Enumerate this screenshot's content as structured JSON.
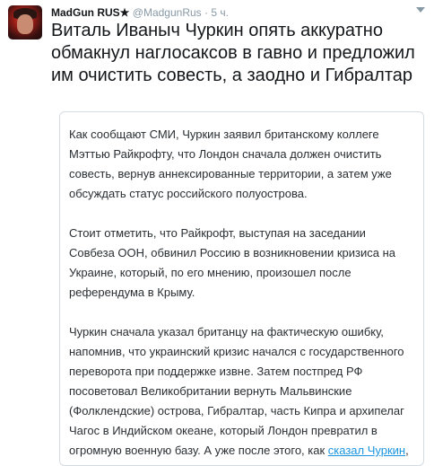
{
  "tweet": {
    "author_name": "MadGun RUS★",
    "handle": "@MadgunRus",
    "separator": "·",
    "time": "5 ч.",
    "text": "Виталь Иваныч Чуркин опять аккуратно обмакнул наглосаксов в гавно и предложил им очистить совесть, а заодно и Гибралтар"
  },
  "quote": {
    "paragraph_1": "Как сообщают СМИ, Чуркин заявил британскому коллеге Мэттью Райкрофту, что Лондон сначала должен очистить совесть, вернув аннексированные территории, а затем уже обсуждать статус российского полуострова.",
    "paragraph_2": "Стоит отметить, что Райкрофт, выступая на заседании Совбеза ООН, обвинил Россию в возникновении кризиса на Украине, который, по его мнению, произошел после референдума в Крыму.",
    "paragraph_3_before_link": "Чуркин сначала указал британцу на фактическую ошибку, напомнив, что украинский кризис начался с государственного переворота при поддержке извне. Затем постпред РФ посоветовал Великобритании вернуть Мальвинские (Фолклендские) острова, Гибралтар, часть Кипра и архипелаг Чагос в Индийском океане, который Лондон превратил в огромную военную базу. А уже после этого, как ",
    "link_text": "сказал Чуркин",
    "paragraph_3_after_link": ", британцы с чистой совестью могут рассуждать о Крыме."
  },
  "colors": {
    "text": "#14171a",
    "secondary": "#8899a6",
    "link": "#1b95e0",
    "border": "#d4dbe0"
  },
  "icons": {
    "avatar": "avatar",
    "menu": "chevron-down-icon"
  }
}
